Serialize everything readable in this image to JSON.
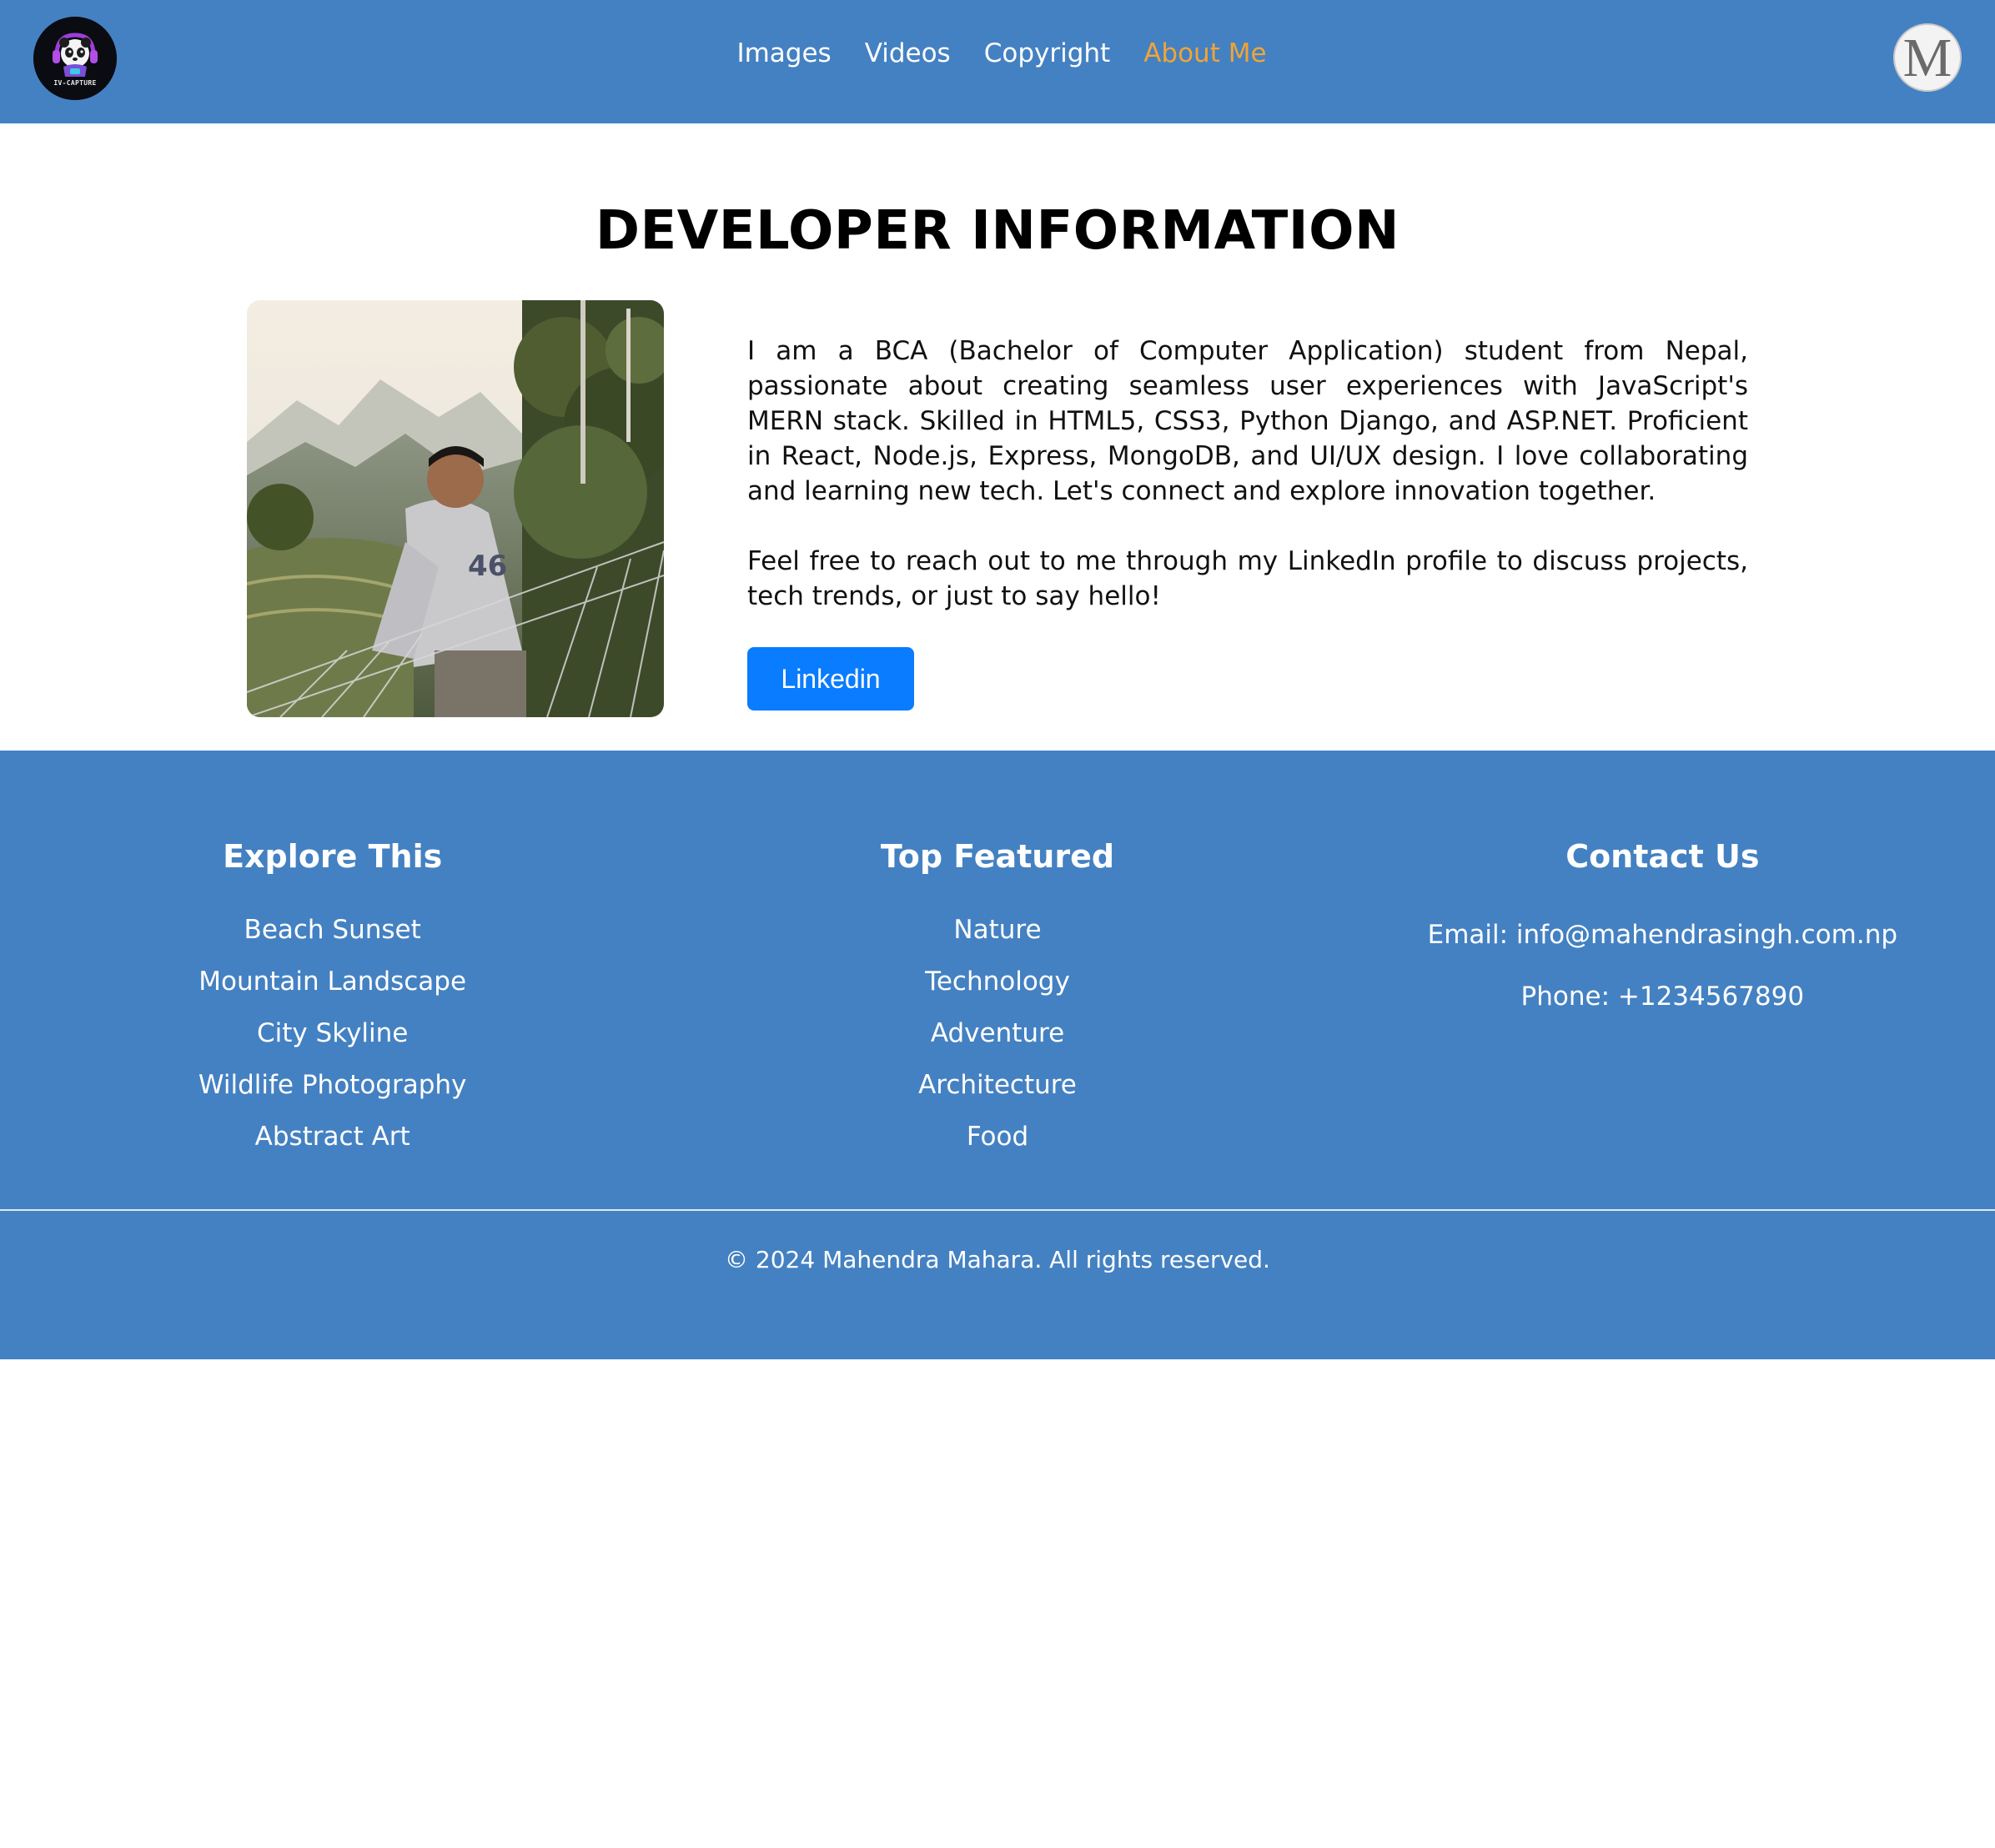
{
  "header": {
    "logo_icon": "panda-logo-icon",
    "nav": [
      {
        "label": "Images",
        "active": false
      },
      {
        "label": "Videos",
        "active": false
      },
      {
        "label": "Copyright",
        "active": false
      },
      {
        "label": "About Me",
        "active": true
      }
    ],
    "avatar_letter": "M"
  },
  "main": {
    "title": "DEVELOPER INFORMATION",
    "bio_paragraphs": [
      "I am a BCA (Bachelor of Computer Application) student from Nepal, passionate about creating seamless user experiences with JavaScript's MERN stack. Skilled in HTML5, CSS3, Python Django, and ASP.NET. Proficient in React, Node.js, Express, MongoDB, and UI/UX design. I love collaborating and learning new tech. Let's connect and explore innovation together.",
      "Feel free to reach out to me through my LinkedIn profile to discuss projects, tech trends, or just to say hello!"
    ],
    "linkedin_label": "Linkedin"
  },
  "footer": {
    "explore": {
      "heading": "Explore This",
      "items": [
        "Beach Sunset",
        "Mountain Landscape",
        "City Skyline",
        "Wildlife Photography",
        "Abstract Art"
      ]
    },
    "featured": {
      "heading": "Top Featured",
      "items": [
        "Nature",
        "Technology",
        "Adventure",
        "Architecture",
        "Food"
      ]
    },
    "contact": {
      "heading": "Contact Us",
      "email": "Email: info@mahendrasingh.com.np",
      "phone": "Phone: +1234567890"
    },
    "copyright": "© 2024 Mahendra Mahara. All rights reserved."
  },
  "colors": {
    "header_bg": "#4481c2",
    "nav_active": "#f0a436",
    "button": "#0a7cff"
  }
}
